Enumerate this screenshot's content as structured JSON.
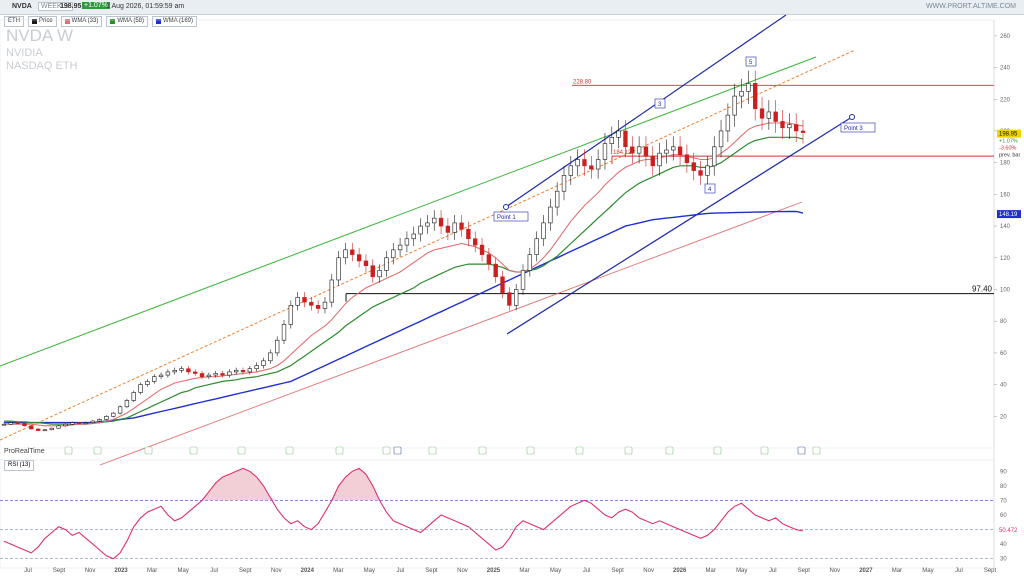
{
  "header": {
    "symbol": "NVDA",
    "period": "WEEKLY",
    "price": "198.95",
    "change": "+1.07%",
    "datetime": "1 Aug 2026, 01:59:59 am",
    "site": "WWW.PRORT.ALTIME.COM"
  },
  "legend": {
    "eth": "ETH",
    "price": "Price",
    "wma33": "WMA (33)",
    "wma58": "WMA (58)",
    "wma169": "WMA (169)"
  },
  "watermark": {
    "title": "NVDA  W",
    "name": "NVIDIA",
    "exchange": "NASDAQ ETH"
  },
  "footer": {
    "brand": "ProRealTime",
    "rsi": "RSI (13)"
  },
  "colors": {
    "up": "#1a1a1a",
    "down": "#cc1f1f",
    "wma33": "#e07070",
    "wma58": "#2e8b2e",
    "wma169": "#1f2fd0",
    "channel": "#1f2aa8",
    "green_line": "#3cb43c",
    "orange_dash": "#f08030",
    "rsi": "#e0306a"
  },
  "chart_data": {
    "type": "line",
    "title": "NVDA W",
    "x_labels": [
      "Jul",
      "Sept",
      "Nov",
      "2023",
      "Mar",
      "May",
      "Jul",
      "Sept",
      "Nov",
      "2024",
      "Mar",
      "May",
      "Jul",
      "Sept",
      "Nov",
      "2025",
      "Mar",
      "May",
      "Jul",
      "Sept",
      "Nov",
      "2026",
      "Mar",
      "May",
      "Jul",
      "Sept",
      "Nov",
      "2027",
      "Mar",
      "May",
      "Jul",
      "Sept"
    ],
    "y_ticks": [
      20,
      40,
      60,
      80,
      100,
      120,
      140,
      160,
      180,
      200,
      220,
      240,
      260
    ],
    "ylim": [
      0,
      270
    ],
    "series": [
      {
        "name": "Price",
        "kind": "candle",
        "close": [
          15,
          16,
          15.5,
          14,
          12,
          11,
          11.5,
          12.5,
          14,
          15,
          16,
          15.5,
          16,
          17,
          18,
          20,
          22,
          26,
          30,
          35,
          40,
          42,
          45,
          46,
          48,
          49,
          50,
          48,
          47,
          45,
          46,
          47,
          46,
          48,
          49,
          48,
          50,
          52,
          55,
          60,
          68,
          78,
          90,
          95,
          92,
          90,
          88,
          92,
          106,
          120,
          125,
          122,
          118,
          115,
          108,
          112,
          120,
          125,
          128,
          132,
          135,
          140,
          142,
          145,
          140,
          136,
          142,
          138,
          132,
          128,
          122,
          116,
          108,
          98,
          90,
          100,
          112,
          122,
          132,
          142,
          152,
          162,
          172,
          178,
          182,
          178,
          176,
          182,
          192,
          196,
          200,
          190,
          186,
          190,
          184,
          178,
          186,
          188,
          190,
          185,
          180,
          175,
          172,
          178,
          190,
          200,
          210,
          222,
          225,
          230,
          214,
          208,
          212,
          206,
          202,
          204,
          200,
          199
        ]
      },
      {
        "name": "WMA (33)",
        "values": [
          15,
          15,
          15,
          15,
          15,
          14.5,
          14,
          14,
          14,
          14,
          14.5,
          15,
          15,
          15.5,
          16,
          17,
          18,
          20,
          22,
          25,
          28,
          31,
          34,
          37,
          39,
          41,
          42,
          43,
          44,
          44.5,
          45,
          45,
          45.5,
          46,
          46.5,
          47,
          47.5,
          48,
          49,
          50,
          52,
          55,
          59,
          63,
          67,
          71,
          74,
          77,
          81,
          86,
          91,
          95,
          98,
          101,
          103,
          105,
          107,
          109,
          111,
          114,
          117,
          120,
          123,
          125,
          126,
          127,
          128,
          129,
          128,
          127,
          125,
          123,
          120,
          116,
          112,
          111,
          111,
          113,
          116,
          120,
          125,
          131,
          137,
          143,
          148,
          153,
          157,
          161,
          166,
          170,
          174,
          177,
          179,
          181,
          182,
          182,
          183,
          184,
          185,
          185,
          184,
          183,
          182,
          182,
          183,
          186,
          189,
          193,
          197,
          201,
          203,
          204,
          205,
          205,
          205,
          205,
          204,
          203
        ]
      },
      {
        "name": "WMA (58)",
        "values": [
          17,
          17,
          16.5,
          16.5,
          16,
          16,
          15.5,
          15,
          15,
          15,
          15,
          15,
          15,
          15.5,
          16,
          16.5,
          17,
          18,
          19,
          21,
          23,
          25,
          27,
          29,
          31,
          33,
          35,
          36,
          38,
          39,
          40,
          41,
          42,
          42.5,
          43,
          44,
          44.5,
          45,
          46,
          47,
          48,
          50,
          52,
          55,
          58,
          61,
          64,
          67,
          70,
          73,
          77,
          80,
          83,
          86,
          89,
          91,
          93,
          95,
          97,
          99,
          101,
          104,
          106,
          108,
          110,
          112,
          114,
          115,
          116,
          116,
          116,
          116,
          115,
          114,
          112,
          111,
          111,
          112,
          113,
          115,
          118,
          121,
          125,
          129,
          133,
          137,
          141,
          145,
          149,
          153,
          157,
          161,
          164,
          167,
          169,
          171,
          173,
          175,
          177,
          178,
          178,
          178,
          177,
          177,
          178,
          180,
          183,
          186,
          189,
          192,
          194,
          195,
          196,
          196,
          196,
          196,
          196,
          195
        ]
      },
      {
        "name": "WMA (169)",
        "values": [
          16,
          16,
          16,
          16,
          16,
          16,
          16,
          16,
          16,
          16,
          16,
          16,
          16,
          16,
          16.5,
          17,
          17.5,
          18,
          18.5,
          19,
          20,
          21,
          22,
          23,
          24,
          25,
          26,
          27,
          28,
          29,
          30,
          31,
          32,
          33,
          34,
          35,
          36,
          37,
          38,
          39,
          40,
          41,
          42,
          44,
          46,
          48,
          50,
          52,
          54,
          56,
          58,
          60,
          62,
          64,
          66,
          68,
          70,
          72,
          74,
          76,
          78,
          80,
          82,
          84,
          86,
          88,
          90,
          92,
          94,
          96,
          98,
          100,
          102,
          104,
          106,
          108,
          110,
          112,
          114,
          116,
          118,
          120,
          122,
          124,
          126,
          128,
          130,
          132,
          134,
          136,
          138,
          140,
          141,
          142,
          143,
          144,
          144.5,
          145,
          145.5,
          146,
          146.5,
          147,
          147.5,
          148,
          148.2,
          148.3,
          148.4,
          148.5,
          148.6,
          148.7,
          148.8,
          148.9,
          149,
          149.1,
          149.1,
          149.2,
          149.2,
          148.2
        ]
      },
      {
        "name": "RSI (13)",
        "values": [
          42,
          40,
          38,
          36,
          34,
          38,
          44,
          48,
          52,
          50,
          46,
          48,
          44,
          40,
          36,
          32,
          30,
          34,
          42,
          52,
          58,
          62,
          64,
          66,
          60,
          56,
          58,
          62,
          66,
          70,
          76,
          82,
          86,
          88,
          90,
          92,
          90,
          86,
          80,
          72,
          64,
          58,
          54,
          56,
          52,
          50,
          54,
          62,
          70,
          80,
          86,
          90,
          92,
          88,
          80,
          70,
          62,
          56,
          54,
          52,
          50,
          48,
          52,
          56,
          60,
          58,
          56,
          54,
          52,
          48,
          44,
          40,
          36,
          38,
          44,
          52,
          56,
          54,
          52,
          50,
          54,
          58,
          62,
          66,
          68,
          70,
          68,
          64,
          60,
          58,
          62,
          64,
          62,
          58,
          56,
          54,
          56,
          54,
          52,
          50,
          48,
          46,
          44,
          46,
          50,
          56,
          62,
          66,
          68,
          64,
          60,
          58,
          56,
          58,
          54,
          52,
          50,
          49
        ]
      }
    ],
    "annotations": [
      {
        "text": "Point 1"
      },
      {
        "text": "Point 3"
      },
      {
        "text": "3"
      },
      {
        "text": "4"
      },
      {
        "text": "5"
      },
      {
        "text": "228.80"
      },
      {
        "text": "184.12"
      },
      {
        "text": "97.40"
      }
    ],
    "last_values": {
      "price": "198.95",
      "wma169": "148.19",
      "rsi": "50.472",
      "change1": "+1.07%",
      "change2": "-3.60%",
      "prev_bar": "prev. bar"
    },
    "rsi_ticks": [
      30,
      40,
      50,
      60,
      70,
      80,
      90
    ],
    "rsi_levels": [
      70,
      50,
      30
    ],
    "levels": [
      228.8,
      184.12,
      97.4
    ]
  }
}
